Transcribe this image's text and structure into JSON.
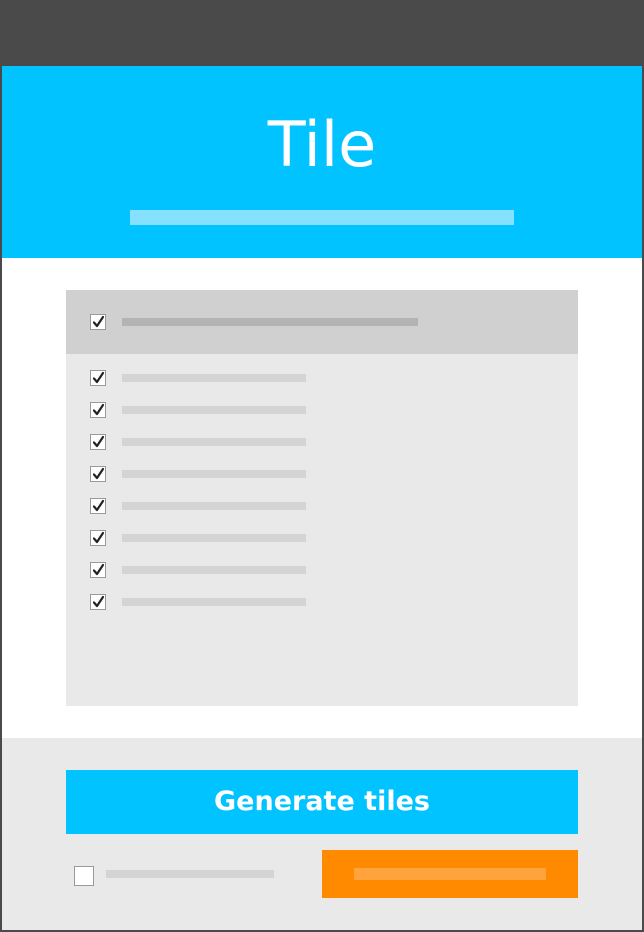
{
  "header": {
    "title": "Tile"
  },
  "select_all": {
    "checked": true
  },
  "items": [
    {
      "checked": true
    },
    {
      "checked": true
    },
    {
      "checked": true
    },
    {
      "checked": true
    },
    {
      "checked": true
    },
    {
      "checked": true
    },
    {
      "checked": true
    },
    {
      "checked": true
    }
  ],
  "footer": {
    "generate_label": "Generate tiles",
    "option_checked": false
  },
  "colors": {
    "accent": "#00c3ff",
    "accent_light": "#86e1ff",
    "orange": "#ff8a00",
    "chrome": "#4a4a4a"
  },
  "icons": {
    "check": "checkmark-icon"
  }
}
